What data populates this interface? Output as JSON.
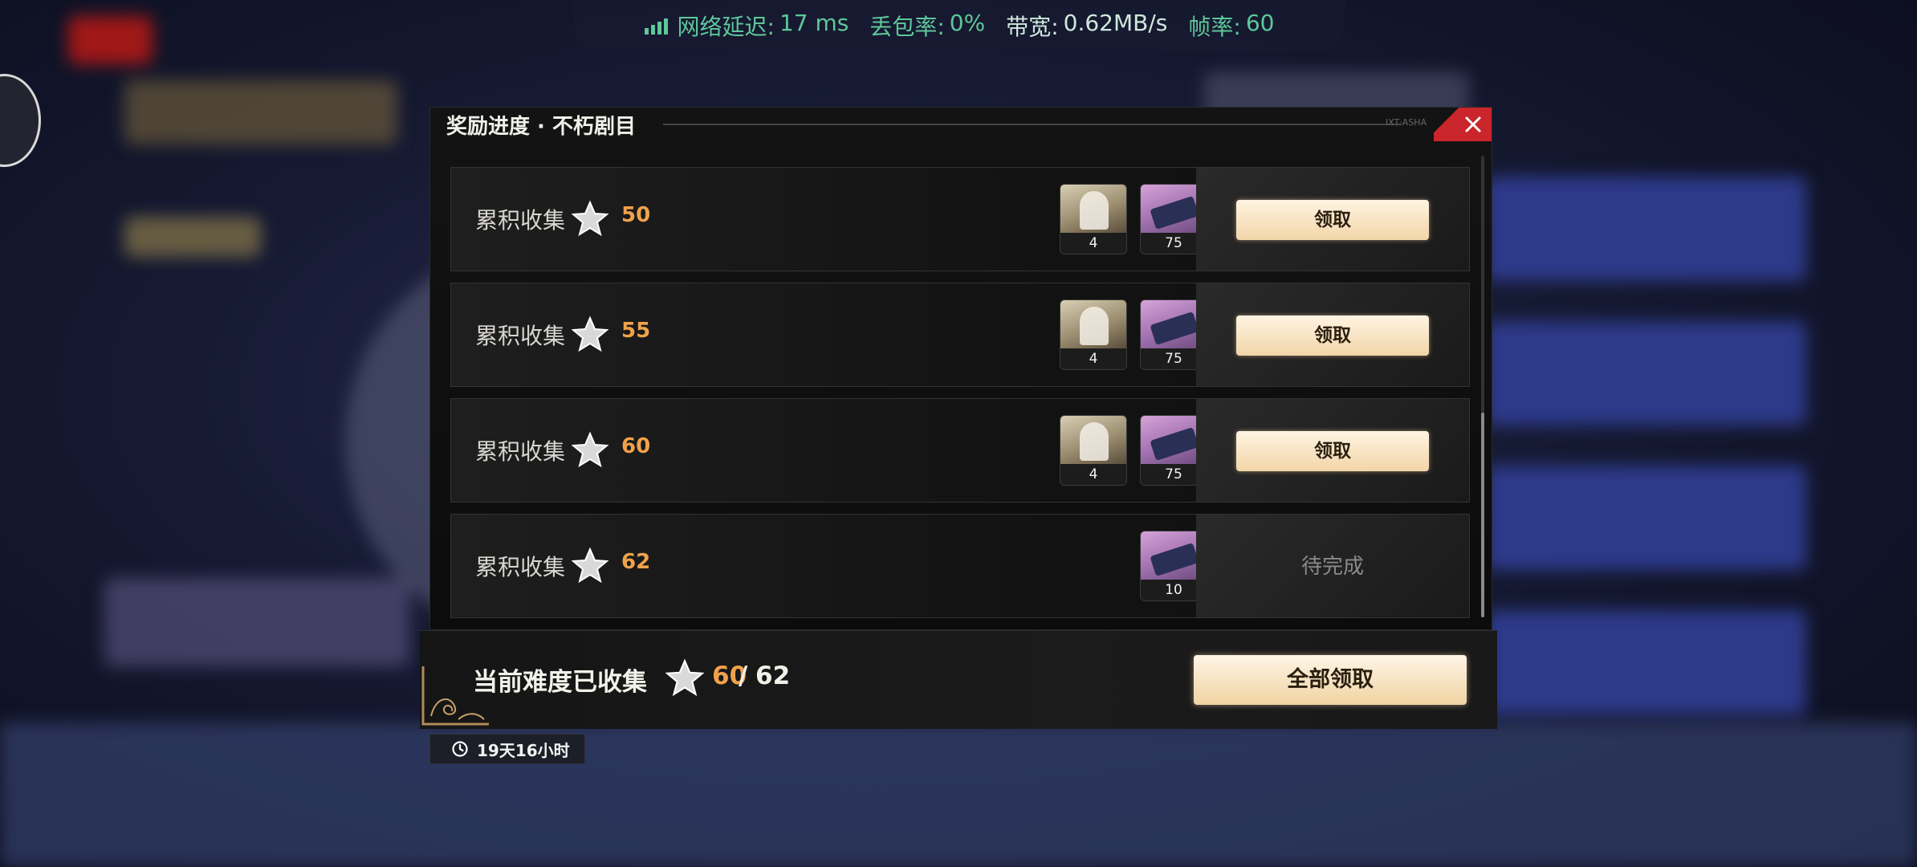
{
  "status_bar": {
    "latency_label": "网络延迟:",
    "latency_value": "17 ms",
    "loss_label": "丢包率:",
    "loss_value": "0%",
    "bandwidth_label": "带宽:",
    "bandwidth_value": "0.62MB/s",
    "fps_label": "帧率:",
    "fps_value": "60"
  },
  "dialog": {
    "title": "奖励进度 · 不朽剧目",
    "header_code": "IXT·ASHA",
    "rows": [
      {
        "label": "累积收集",
        "goal": "50",
        "rewards": [
          {
            "type": "character",
            "qty": "4"
          },
          {
            "type": "ticket",
            "qty": "75"
          }
        ],
        "action": "领取",
        "status": "claimable"
      },
      {
        "label": "累积收集",
        "goal": "55",
        "rewards": [
          {
            "type": "character",
            "qty": "4"
          },
          {
            "type": "ticket",
            "qty": "75"
          }
        ],
        "action": "领取",
        "status": "claimable"
      },
      {
        "label": "累积收集",
        "goal": "60",
        "rewards": [
          {
            "type": "character",
            "qty": "4"
          },
          {
            "type": "ticket",
            "qty": "75"
          }
        ],
        "action": "领取",
        "status": "claimable"
      },
      {
        "label": "累积收集",
        "goal": "62",
        "rewards": [
          {
            "type": "ticket",
            "qty": "10"
          }
        ],
        "action": "待完成",
        "status": "pending"
      }
    ]
  },
  "footer": {
    "label": "当前难度已收集",
    "current": "60",
    "separator": "/",
    "total": "62",
    "claim_all": "全部领取"
  },
  "timer": {
    "text": "19天16小时"
  },
  "colors": {
    "accent_orange": "#f0a24b",
    "close_red": "#c9252b",
    "net_green": "#5fc79a",
    "button_cream": "#f2d5a8"
  },
  "icons": {
    "star": "star-icon",
    "close": "close-icon",
    "clock": "clock-icon",
    "signal": "signal-icon"
  }
}
